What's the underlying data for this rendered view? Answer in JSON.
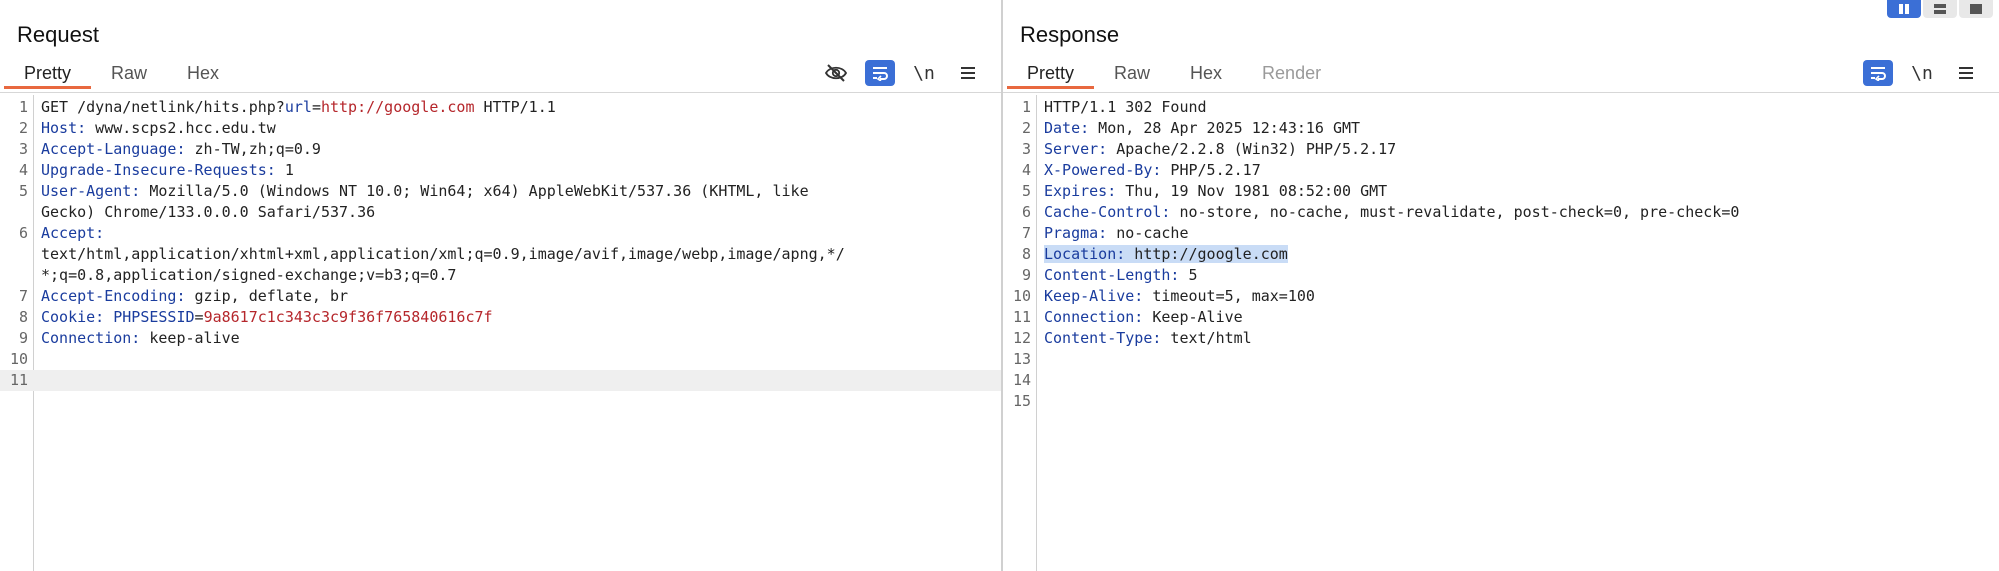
{
  "request": {
    "title": "Request",
    "tabs": [
      {
        "label": "Pretty"
      },
      {
        "label": "Raw"
      },
      {
        "label": "Hex"
      }
    ],
    "toolbar": {
      "newline_label": "\\n"
    },
    "lines": [
      {
        "num": "1",
        "parts": [
          {
            "t": "GET /dyna/netlink/hits.php?",
            "c": "val"
          },
          {
            "t": "url",
            "c": "key"
          },
          {
            "t": "=",
            "c": "val"
          },
          {
            "t": "http://google.com",
            "c": "red"
          },
          {
            "t": " HTTP/1.1",
            "c": "val"
          }
        ]
      },
      {
        "num": "2",
        "parts": [
          {
            "t": "Host:",
            "c": "key"
          },
          {
            "t": " www.scps2.hcc.edu.tw",
            "c": "val"
          }
        ]
      },
      {
        "num": "3",
        "parts": [
          {
            "t": "Accept-Language:",
            "c": "key"
          },
          {
            "t": " zh-TW,zh;q=0.9",
            "c": "val"
          }
        ]
      },
      {
        "num": "4",
        "parts": [
          {
            "t": "Upgrade-Insecure-Requests:",
            "c": "key"
          },
          {
            "t": " 1",
            "c": "val"
          }
        ]
      },
      {
        "num": "5",
        "parts": [
          {
            "t": "User-Agent:",
            "c": "key"
          },
          {
            "t": " Mozilla/5.0 (Windows NT 10.0; Win64; x64) AppleWebKit/537.36 (KHTML, like",
            "c": "val"
          }
        ]
      },
      {
        "num": "",
        "parts": [
          {
            "t": "Gecko) Chrome/133.0.0.0 Safari/537.36",
            "c": "val"
          }
        ]
      },
      {
        "num": "6",
        "parts": [
          {
            "t": "Accept:",
            "c": "key"
          }
        ]
      },
      {
        "num": "",
        "parts": [
          {
            "t": "text/html,application/xhtml+xml,application/xml;q=0.9,image/avif,image/webp,image/apng,*/",
            "c": "val"
          }
        ]
      },
      {
        "num": "",
        "parts": [
          {
            "t": "*;q=0.8,application/signed-exchange;v=b3;q=0.7",
            "c": "val"
          }
        ]
      },
      {
        "num": "7",
        "parts": [
          {
            "t": "Accept-Encoding:",
            "c": "key"
          },
          {
            "t": " gzip, deflate, br",
            "c": "val"
          }
        ]
      },
      {
        "num": "8",
        "parts": [
          {
            "t": "Cookie:",
            "c": "key"
          },
          {
            "t": " ",
            "c": "val"
          },
          {
            "t": "PHPSESSID",
            "c": "key"
          },
          {
            "t": "=",
            "c": "val"
          },
          {
            "t": "9a8617c1c343c3c9f36f765840616c7f",
            "c": "red"
          }
        ]
      },
      {
        "num": "9",
        "parts": [
          {
            "t": "Connection:",
            "c": "key"
          },
          {
            "t": " keep-alive",
            "c": "val"
          }
        ]
      },
      {
        "num": "10",
        "parts": []
      },
      {
        "num": "11",
        "parts": [],
        "current": true
      }
    ]
  },
  "response": {
    "title": "Response",
    "tabs": [
      {
        "label": "Pretty"
      },
      {
        "label": "Raw"
      },
      {
        "label": "Hex"
      },
      {
        "label": "Render"
      }
    ],
    "toolbar": {
      "newline_label": "\\n"
    },
    "lines": [
      {
        "num": "1",
        "parts": [
          {
            "t": "HTTP/1.1 302 Found",
            "c": "val"
          }
        ]
      },
      {
        "num": "2",
        "parts": [
          {
            "t": "Date:",
            "c": "key"
          },
          {
            "t": " Mon, 28 Apr 2025 12:43:16 GMT",
            "c": "val"
          }
        ]
      },
      {
        "num": "3",
        "parts": [
          {
            "t": "Server:",
            "c": "key"
          },
          {
            "t": " Apache/2.2.8 (Win32) PHP/5.2.17",
            "c": "val"
          }
        ]
      },
      {
        "num": "4",
        "parts": [
          {
            "t": "X-Powered-By:",
            "c": "key"
          },
          {
            "t": " PHP/5.2.17",
            "c": "val"
          }
        ]
      },
      {
        "num": "5",
        "parts": [
          {
            "t": "Expires:",
            "c": "key"
          },
          {
            "t": " Thu, 19 Nov 1981 08:52:00 GMT",
            "c": "val"
          }
        ]
      },
      {
        "num": "6",
        "parts": [
          {
            "t": "Cache-Control:",
            "c": "key"
          },
          {
            "t": " no-store, no-cache, must-revalidate, post-check=0, pre-check=0",
            "c": "val"
          }
        ]
      },
      {
        "num": "7",
        "parts": [
          {
            "t": "Pragma:",
            "c": "key"
          },
          {
            "t": " no-cache",
            "c": "val"
          }
        ]
      },
      {
        "num": "8",
        "parts": [
          {
            "t": "Location:",
            "c": "key"
          },
          {
            "t": " http://google.com",
            "c": "val"
          }
        ],
        "selected": true
      },
      {
        "num": "9",
        "parts": [
          {
            "t": "Content-Length:",
            "c": "key"
          },
          {
            "t": " 5",
            "c": "val"
          }
        ]
      },
      {
        "num": "10",
        "parts": [
          {
            "t": "Keep-Alive:",
            "c": "key"
          },
          {
            "t": " timeout=5, max=100",
            "c": "val"
          }
        ]
      },
      {
        "num": "11",
        "parts": [
          {
            "t": "Connection:",
            "c": "key"
          },
          {
            "t": " Keep-Alive",
            "c": "val"
          }
        ]
      },
      {
        "num": "12",
        "parts": [
          {
            "t": "Content-Type:",
            "c": "key"
          },
          {
            "t": " text/html",
            "c": "val"
          }
        ]
      },
      {
        "num": "13",
        "parts": []
      },
      {
        "num": "14",
        "parts": []
      },
      {
        "num": "15",
        "parts": []
      }
    ]
  },
  "colors": {
    "accent": "#e8683f",
    "toggle_on": "#3b6fd6",
    "header_key": "#1a3c9e",
    "value_red": "#b5262b",
    "selection": "#c9dcf6"
  },
  "icons": {
    "request_toolbar": [
      "eye-slash-icon",
      "wrap-icon",
      "newline-icon",
      "menu-icon"
    ],
    "response_toolbar": [
      "wrap-icon",
      "newline-icon",
      "menu-icon"
    ],
    "layout_switch": [
      "side-by-side-icon",
      "stacked-icon",
      "single-pane-icon"
    ]
  }
}
